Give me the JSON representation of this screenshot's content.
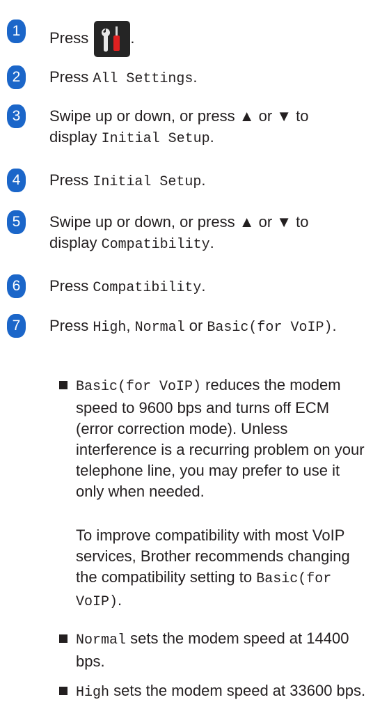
{
  "steps": [
    {
      "num": "1",
      "text_a": "Press",
      "text_b": "."
    },
    {
      "num": "2",
      "text_a": "Press ",
      "mono_a": "All Settings",
      "text_b": "."
    },
    {
      "num": "3",
      "text_a": "Swipe up or down, or press ▲ or ▼ to display ",
      "mono_a": "Initial Setup",
      "text_b": "."
    },
    {
      "num": "4",
      "text_a": "Press ",
      "mono_a": "Initial Setup",
      "text_b": "."
    },
    {
      "num": "5",
      "text_a": "Swipe up or down, or press ▲ or ▼ to display ",
      "mono_a": "Compatibility",
      "text_b": "."
    },
    {
      "num": "6",
      "text_a": "Press ",
      "mono_a": "Compatibility",
      "text_b": "."
    },
    {
      "num": "7",
      "text_a": "Press ",
      "mono_a": "High",
      "text_b": ", ",
      "mono_b": "Normal",
      "text_c": " or ",
      "mono_c": "Basic(for VoIP)",
      "text_d": "."
    }
  ],
  "bullets": [
    {
      "mono": "Basic(for VoIP)",
      "text": " reduces the modem speed to 9600 bps and turns off ECM (error correction mode). Unless interference is a recurring problem on your telephone line, you may prefer to use it only when needed.",
      "para_text": "To improve compatibility with most VoIP services, Brother recommends changing the compatibility setting to ",
      "para_mono": "Basic(for VoIP)",
      "para_end": "."
    },
    {
      "mono": "Normal",
      "text": " sets the modem speed at 14400 bps."
    },
    {
      "mono": "High",
      "text": " sets the modem speed at 33600 bps."
    }
  ],
  "icon_name": "settings-tools-icon"
}
